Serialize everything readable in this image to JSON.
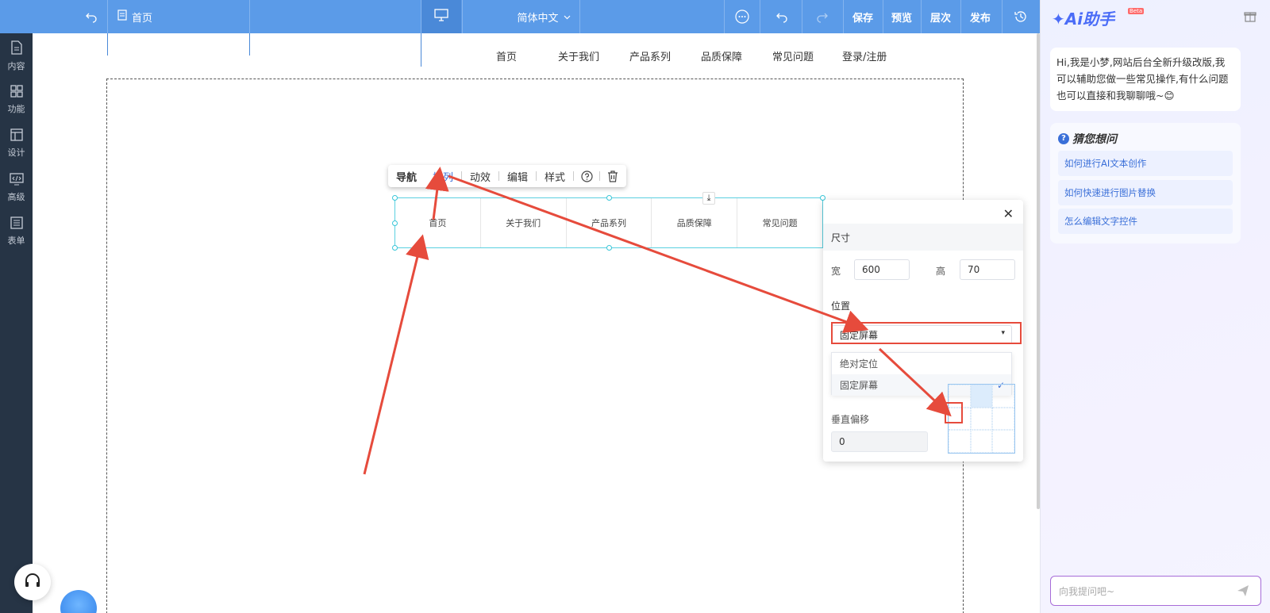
{
  "topbar": {
    "page_name": "首页",
    "language": "简体中文",
    "save": "保存",
    "preview": "预览",
    "layers": "层次",
    "publish": "发布"
  },
  "leftbar": {
    "items": [
      {
        "label": "内容",
        "icon": "document-icon"
      },
      {
        "label": "功能",
        "icon": "grid-icon"
      },
      {
        "label": "设计",
        "icon": "layout-icon"
      },
      {
        "label": "高级",
        "icon": "code-icon"
      },
      {
        "label": "表单",
        "icon": "form-icon"
      }
    ]
  },
  "site_nav": [
    "首页",
    "关于我们",
    "产品系列",
    "品质保障",
    "常见问题",
    "登录/注册"
  ],
  "toolbar": {
    "nav": "导航",
    "arrange": "排列",
    "motion": "动效",
    "edit": "编辑",
    "style": "样式"
  },
  "nav_widget": [
    "首页",
    "关于我们",
    "产品系列",
    "品质保障",
    "常见问题"
  ],
  "panel": {
    "size_title": "尺寸",
    "width_label": "宽",
    "width_value": "600",
    "height_label": "高",
    "height_value": "70",
    "position_title": "位置",
    "position_value": "固定屏幕",
    "options": [
      "绝对定位",
      "固定屏幕"
    ],
    "vertical_offset_label": "垂直偏移",
    "vertical_offset_value": "0"
  },
  "ai": {
    "title": "Ai助手",
    "beta": "Beta",
    "greeting": "Hi,我是小梦,网站后台全新升级改版,我可以辅助您做一些常见操作,有什么问题也可以直接和我聊聊哦~",
    "guess_title": "猜您想问",
    "questions": [
      "如何进行AI文本创作",
      "如何快速进行图片替换",
      "怎么编辑文字控件"
    ],
    "input_placeholder": "向我提问吧~"
  },
  "colors": {
    "topbar": "#5b9be8",
    "sidebar": "#263445",
    "accent": "#3a6fd8",
    "annotation": "#e64b3c"
  }
}
